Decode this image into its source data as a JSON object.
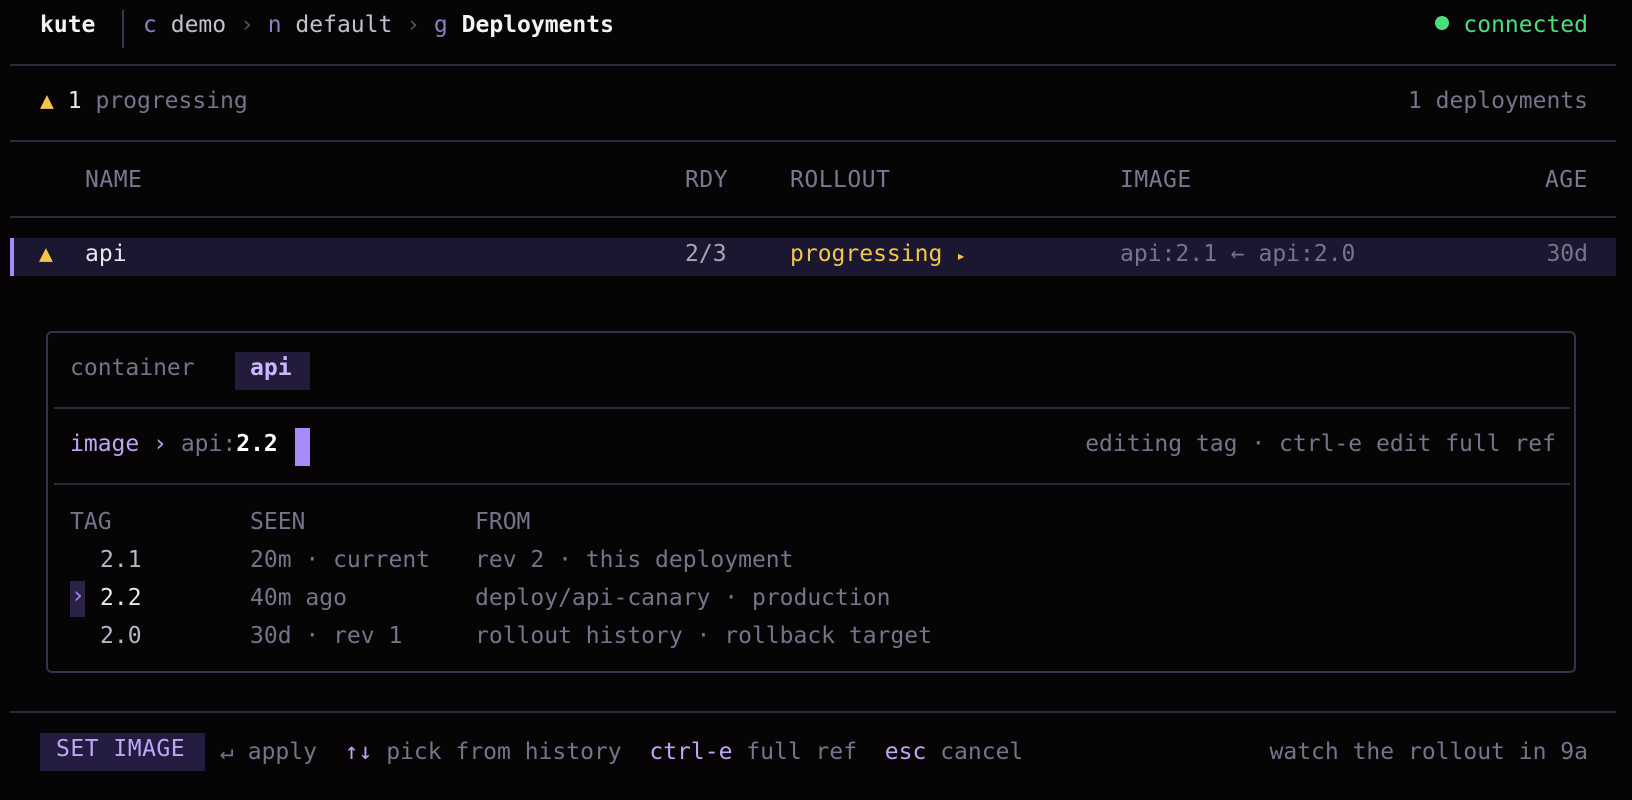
{
  "header": {
    "app": "kute",
    "breadcrumb": [
      {
        "key": "c",
        "value": "demo"
      },
      {
        "key": "n",
        "value": "default"
      },
      {
        "key": "g",
        "value": "Deployments"
      }
    ],
    "separator": "›",
    "status": "connected",
    "status_color": "#4ade80"
  },
  "summary": {
    "icon": "warning-triangle-icon",
    "glyph": "▲",
    "count": "1",
    "label": "progressing",
    "total": "1 deployments"
  },
  "table": {
    "columns": [
      "NAME",
      "RDY",
      "ROLLOUT",
      "IMAGE",
      "AGE"
    ],
    "rows": [
      {
        "status_glyph": "▲",
        "name": "api",
        "ready": "2/3",
        "rollout": "progressing",
        "rollout_glyph": "▸",
        "image": "api:2.1 ← api:2.0",
        "age": "30d"
      }
    ]
  },
  "panel": {
    "container_label": "container",
    "container_value": "api",
    "image_label": "image",
    "image_arrow": "›",
    "image_prefix": "api:",
    "image_tag": "2.2",
    "hint": "editing tag · ctrl-e edit full ref",
    "history_columns": [
      "TAG",
      "SEEN",
      "FROM"
    ],
    "history": [
      {
        "tag": "2.1",
        "seen": "20m · current",
        "from": "rev 2 · this deployment",
        "selected": false
      },
      {
        "tag": "2.2",
        "seen": "40m ago",
        "from": "deploy/api-canary · production",
        "selected": true
      },
      {
        "tag": "2.0",
        "seen": "30d · rev 1",
        "from": "rollout history · rollback target",
        "selected": false
      }
    ],
    "selection_glyph": "›"
  },
  "footer": {
    "mode": "SET IMAGE",
    "shortcuts": [
      {
        "key": "↵",
        "label": "apply"
      },
      {
        "key": "↑↓",
        "label": "pick from history"
      },
      {
        "key": "ctrl-e",
        "label": "full ref"
      },
      {
        "key": "esc",
        "label": "cancel"
      }
    ],
    "right_hint": "watch the rollout in 9a"
  },
  "colors": {
    "background": "#070405",
    "accent": "#a78bfa",
    "warning": "#f3c64a",
    "selected_row": "#1c1730"
  }
}
